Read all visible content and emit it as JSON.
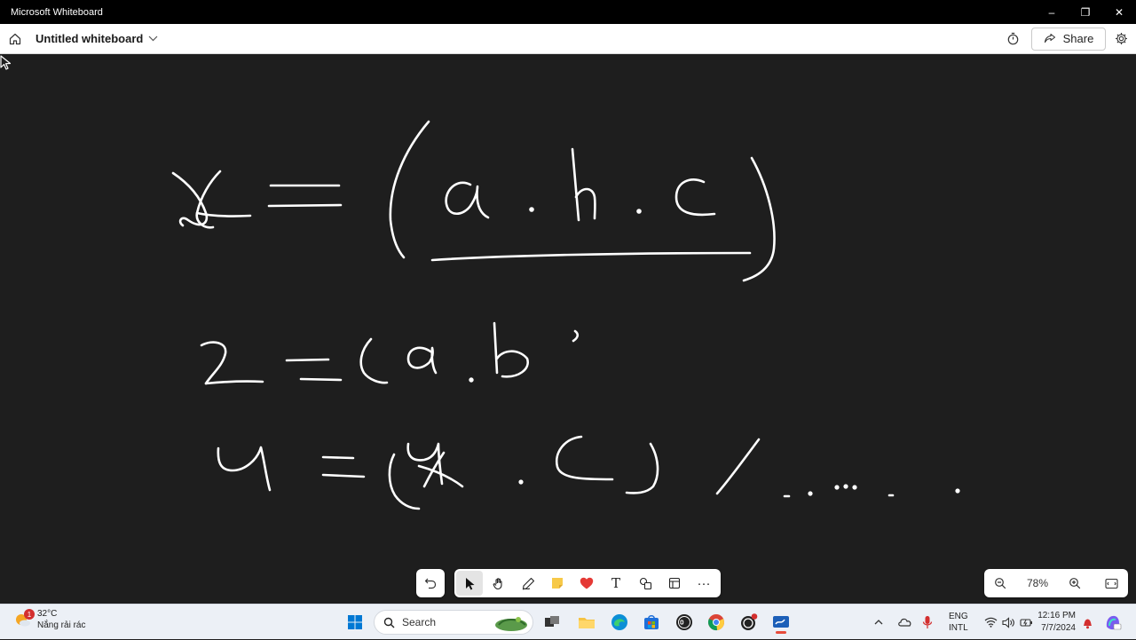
{
  "window": {
    "app_title": "Microsoft Whiteboard",
    "controls": {
      "minimize": "–",
      "restore": "❐",
      "close": "✕"
    }
  },
  "header": {
    "board_title": "Untitled whiteboard",
    "share_label": "Share"
  },
  "canvas": {
    "background": "#1e1e1e",
    "ink_color": "#ffffff",
    "ink_description": "handwritten ink strokes"
  },
  "toolbar": {
    "tools": [
      "undo",
      "select",
      "hand",
      "pen",
      "sticky-note",
      "reactions",
      "text",
      "shapes",
      "templates",
      "more"
    ],
    "active_tool": "select",
    "more_label": "···",
    "text_label": "T"
  },
  "zoom": {
    "level": "78%"
  },
  "taskbar": {
    "weather_temp": "32°C",
    "weather_desc": "Nắng rải rác",
    "weather_badge": "1",
    "search_placeholder": "Search",
    "language_top": "ENG",
    "language_bottom": "INTL",
    "time": "12:16 PM",
    "date": "7/7/2024",
    "colors": {
      "accent": "#0078d4",
      "alert": "#d32f2f"
    }
  }
}
